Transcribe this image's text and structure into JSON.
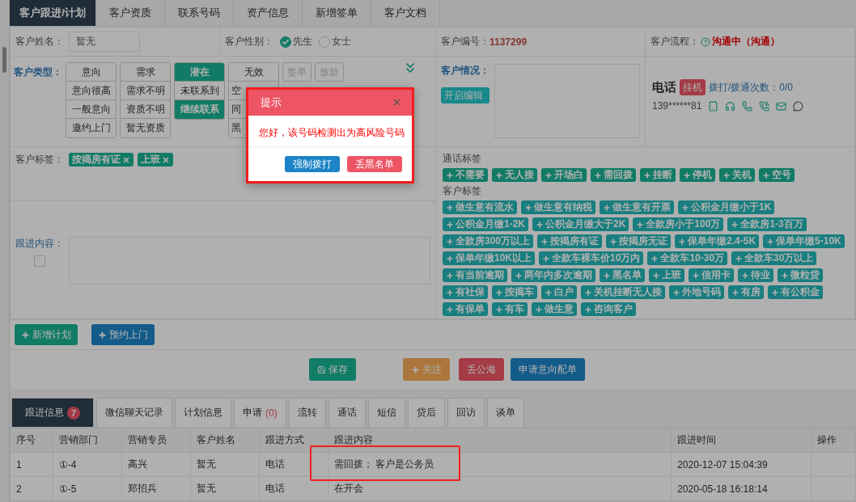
{
  "top_tabs": [
    {
      "label": "客户跟进/计划",
      "selected": true
    },
    {
      "label": "客户资质",
      "selected": false
    },
    {
      "label": "联系号码",
      "selected": false
    },
    {
      "label": "资产信息",
      "selected": false
    },
    {
      "label": "新增签单",
      "selected": false
    },
    {
      "label": "客户文档",
      "selected": false
    }
  ],
  "name_field": {
    "label": "客户姓名：",
    "value": "暂无"
  },
  "gender": {
    "label": "客户性别：",
    "options": [
      {
        "label": "先生",
        "selected": true
      },
      {
        "label": "女士",
        "selected": false
      }
    ]
  },
  "customer_id": {
    "label": "客户编号：",
    "value": "1137299"
  },
  "flow": {
    "label": "客户流程：",
    "value": "沟通中（沟通）"
  },
  "customer_type": {
    "label": "客户类型：",
    "groups": [
      {
        "items": [
          {
            "label": "意向",
            "selected": false
          },
          {
            "label": "意向很高",
            "selected": false
          },
          {
            "label": "一般意向",
            "selected": false
          },
          {
            "label": "邀约上门",
            "selected": false
          }
        ]
      },
      {
        "items": [
          {
            "label": "需求",
            "selected": false
          },
          {
            "label": "需求不明",
            "selected": false
          },
          {
            "label": "资质不明",
            "selected": false
          },
          {
            "label": "暂无资质",
            "selected": false
          }
        ]
      },
      {
        "items": [
          {
            "label": "潜在",
            "selected": true
          },
          {
            "label": "未联系到",
            "selected": false
          },
          {
            "label": "继续联系",
            "selected": true
          }
        ]
      },
      {
        "items": [
          {
            "label": "无效",
            "selected": false
          },
          {
            "label": "空",
            "selected": false
          },
          {
            "label": "同",
            "selected": false
          },
          {
            "label": "黑",
            "selected": false
          }
        ]
      }
    ],
    "extra_buttons": [
      {
        "label": "签单",
        "disabled": true
      },
      {
        "label": "放款",
        "disabled": true
      }
    ]
  },
  "situation": {
    "label": "客户情况：",
    "button": "开启编辑"
  },
  "phone": {
    "title": "电话",
    "status": "挂机",
    "counts": "拨打/拨通次数：0/0",
    "number": "139******81"
  },
  "customer_tags": {
    "label": "客户标签：",
    "items": [
      "按揭房有证",
      "上班"
    ]
  },
  "call_tags": {
    "title": "通话标签",
    "items": [
      "不需要",
      "无人接",
      "开场白",
      "需回拨",
      "挂断",
      "停机",
      "关机",
      "空号"
    ]
  },
  "tag_pool": {
    "title": "客户标签",
    "items": [
      "做生意有流水",
      "做生意有纳税",
      "做生意有开票",
      "公积金月缴小于1K",
      "公积金月缴1-2K",
      "公积金月缴大于2K",
      "全款房小于100万",
      "全款房1-3百万",
      "全款房300万以上",
      "按揭房有证",
      "按揭房无证",
      "保单年缴2.4-5K",
      "保单年缴5-10K",
      "保单年缴10K以上",
      "全款车裸车价10万内",
      "全款车10-30万",
      "全款车30万以上",
      "有当前逾期",
      "两年内多次逾期",
      "黑名单",
      "上班",
      "信用卡",
      "待业",
      "微粒贷",
      "有社保",
      "按揭车",
      "白户",
      "关机挂断无人接",
      "外地号码",
      "有房",
      "有公积金",
      "有保单",
      "有车",
      "做生意",
      "咨询客户"
    ]
  },
  "follow_content": {
    "label": "跟进内容：",
    "checked": false
  },
  "plan_buttons": [
    {
      "label": "新增计划",
      "kind": "add",
      "color": "#127c66"
    },
    {
      "label": "预约上门",
      "kind": "add",
      "color": "#135b89"
    }
  ],
  "action_buttons": [
    {
      "label": "保存",
      "kind": "save",
      "color": "#127c66"
    },
    {
      "label": "关注",
      "kind": "add",
      "color": "#ab773d"
    },
    {
      "label": "丢公海",
      "kind": "plain",
      "color": "#a43b46"
    },
    {
      "label": "申请意向配单",
      "kind": "plain",
      "color": "#135b89"
    }
  ],
  "bottom_tabs": [
    {
      "label": "跟进信息",
      "badge": "7",
      "selected": true
    },
    {
      "label": "微信聊天记录",
      "selected": false
    },
    {
      "label": "计划信息",
      "selected": false
    },
    {
      "label": "申请",
      "count": "(0)",
      "selected": false
    },
    {
      "label": "流转",
      "selected": false
    },
    {
      "label": "通话",
      "selected": false
    },
    {
      "label": "短信",
      "selected": false
    },
    {
      "label": "贷后",
      "selected": false
    },
    {
      "label": "回访",
      "selected": false
    },
    {
      "label": "谈单",
      "selected": false
    }
  ],
  "table": {
    "columns": [
      "序号",
      "营销部门",
      "营销专员",
      "客户姓名",
      "跟进方式",
      "跟进内容",
      "跟进时间",
      "操作"
    ],
    "rows": [
      [
        "1",
        "①-4",
        "高兴",
        "暂无",
        "电话",
        "需回拨； 客户是公务员",
        "2020-12-07 15:04:39",
        ""
      ],
      [
        "2",
        "①-5",
        "郑招兵",
        "暂无",
        "电话",
        "在开会",
        "2020-05-18 16:18:14",
        ""
      ]
    ]
  },
  "dialog": {
    "title": "提示",
    "message": "您好，该号码检测出为高风险号码",
    "buttons": [
      {
        "label": "强制拨打",
        "color": "#1c84c6"
      },
      {
        "label": "丢黑名单",
        "color": "#ed5565"
      }
    ]
  }
}
